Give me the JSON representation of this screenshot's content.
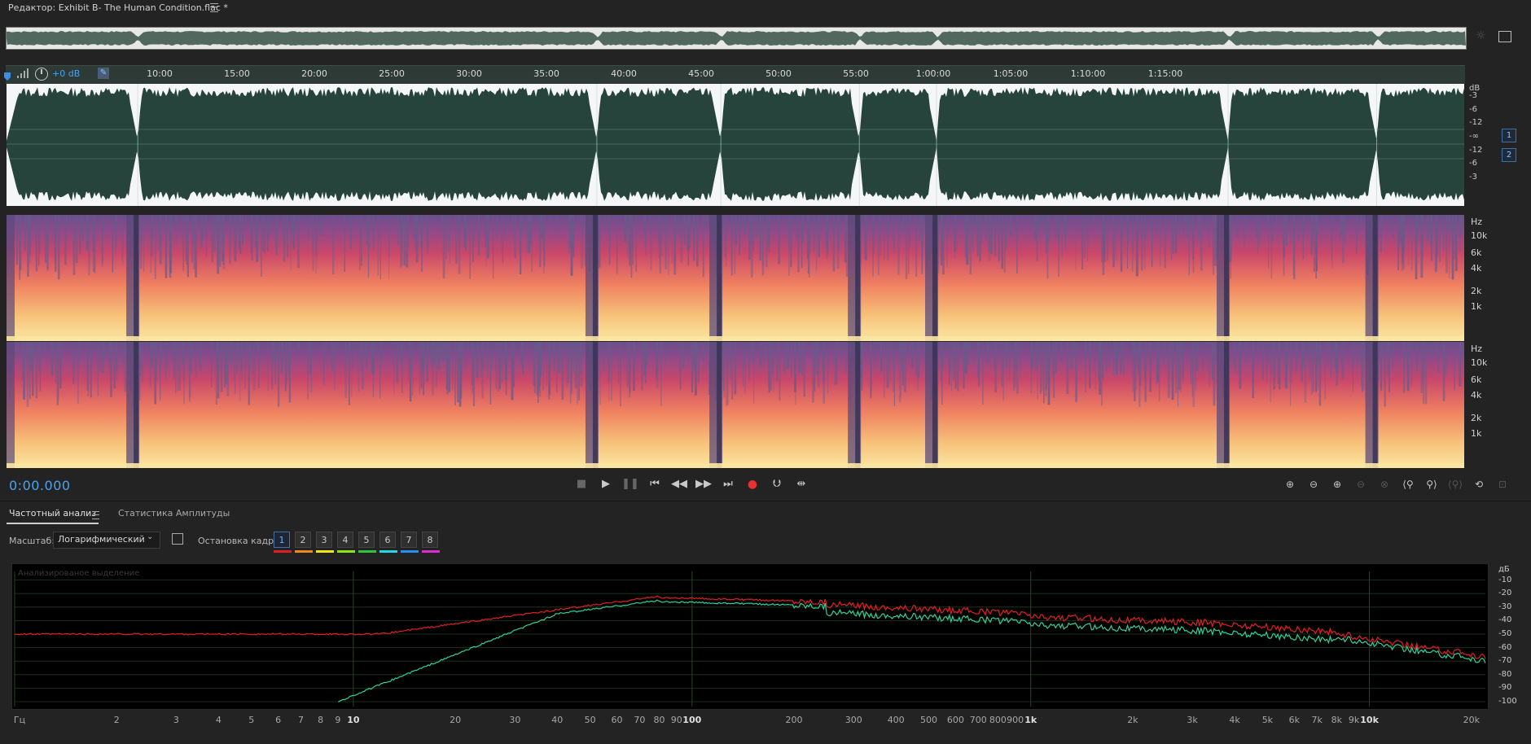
{
  "titlebar": {
    "title": "Редактор: Exhibit B- The Human Condition.flac *"
  },
  "ruler": {
    "labels": [
      "10:00",
      "15:00",
      "20:00",
      "25:00",
      "30:00",
      "35:00",
      "40:00",
      "45:00",
      "50:00",
      "55:00",
      "1:00:00",
      "1:05:00",
      "1:10:00",
      "1:15:00"
    ]
  },
  "gain": {
    "value": "+0 dB"
  },
  "waveform": {
    "db_labels": [
      "dB",
      "-3",
      "-6",
      "-12",
      "-∞",
      "-12",
      "-6",
      "-3"
    ],
    "channels": [
      "1",
      "2"
    ]
  },
  "spectrogram": {
    "hz_labels": [
      "Hz",
      "10k",
      "6k",
      "4k",
      "2k",
      "1k"
    ]
  },
  "transport": {
    "time": "0:00.000"
  },
  "panel": {
    "tab_frequency": "Частотный анализ",
    "tab_amplitude": "Статистика Амплитуды",
    "scale_label": "Масштаб:",
    "scale_value": "Логарифмический",
    "freeze_label": "Остановка кадра:",
    "frames": [
      {
        "label": "1",
        "color": "#e02020"
      },
      {
        "label": "2",
        "color": "#f08a1c"
      },
      {
        "label": "3",
        "color": "#f2e51c"
      },
      {
        "label": "4",
        "color": "#8ee21c"
      },
      {
        "label": "5",
        "color": "#2fc43a"
      },
      {
        "label": "6",
        "color": "#23d6e0"
      },
      {
        "label": "7",
        "color": "#2a8cf2"
      },
      {
        "label": "8",
        "color": "#e02ad6"
      }
    ],
    "analyzed_label": "Анализированое выделение",
    "x_labels": [
      "Гц",
      "2",
      "3",
      "4",
      "5",
      "6",
      "7",
      "8",
      "9",
      "10",
      "20",
      "30",
      "40",
      "50",
      "60",
      "70",
      "80",
      "90",
      "100",
      "200",
      "300",
      "400",
      "500",
      "600",
      "700",
      "800",
      "900",
      "1k",
      "2k",
      "3k",
      "4k",
      "5k",
      "6k",
      "7k",
      "8k",
      "9k",
      "10k",
      "20k"
    ],
    "y_labels": [
      "дБ",
      "-10",
      "-20",
      "-30",
      "-40",
      "-50",
      "-60",
      "-70",
      "-80",
      "-90",
      "-100"
    ],
    "colors": {
      "red_curve": "#e02020",
      "green_curve": "#2fd09a"
    }
  }
}
